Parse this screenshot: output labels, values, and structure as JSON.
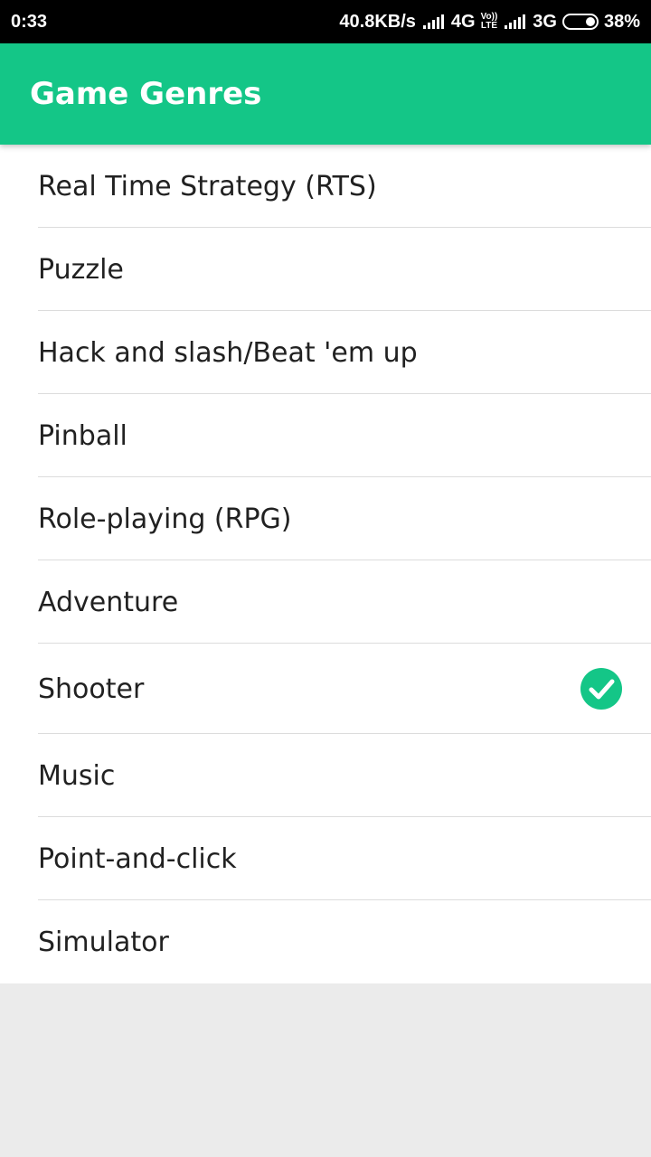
{
  "status_bar": {
    "time": "0:33",
    "net_speed": "40.8KB/s",
    "network1": "4G",
    "volte_top": "Vo))",
    "volte_bottom": "LTE",
    "network2": "3G",
    "battery": "38%"
  },
  "app_bar": {
    "title": "Game Genres"
  },
  "genres": [
    {
      "label": "Real Time Strategy (RTS)",
      "selected": false
    },
    {
      "label": "Puzzle",
      "selected": false
    },
    {
      "label": "Hack and slash/Beat 'em up",
      "selected": false
    },
    {
      "label": "Pinball",
      "selected": false
    },
    {
      "label": "Role-playing (RPG)",
      "selected": false
    },
    {
      "label": "Adventure",
      "selected": false
    },
    {
      "label": "Shooter",
      "selected": true
    },
    {
      "label": "Music",
      "selected": false
    },
    {
      "label": "Point-and-click",
      "selected": false
    },
    {
      "label": "Simulator",
      "selected": false
    }
  ],
  "colors": {
    "accent": "#14c687",
    "background": "#ebebeb"
  },
  "icons": {
    "selected": "check-circle-icon"
  }
}
